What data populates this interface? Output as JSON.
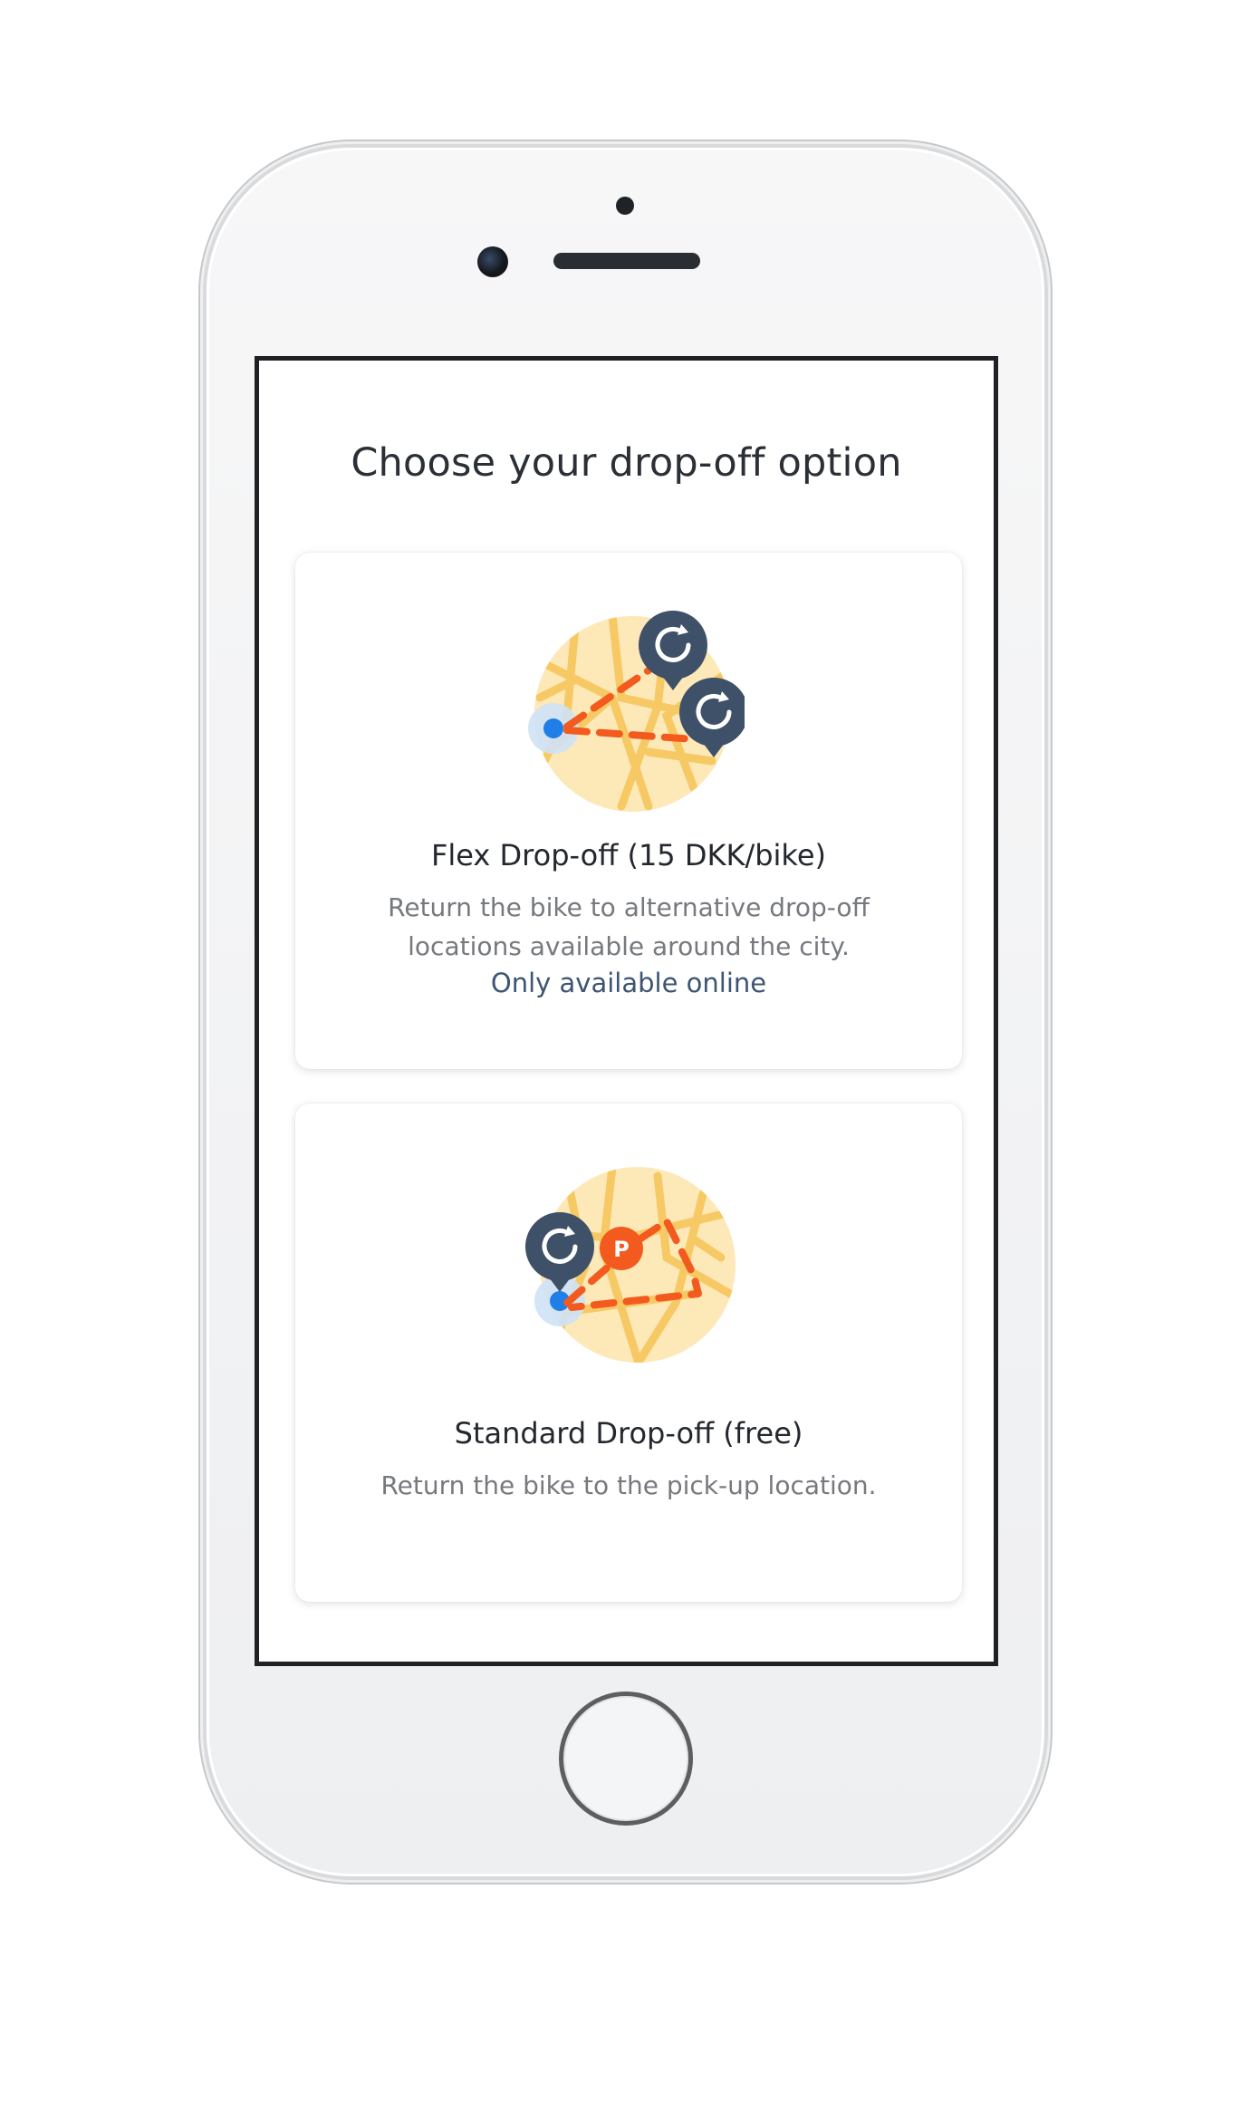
{
  "page": {
    "title": "Choose your drop-off option"
  },
  "options": [
    {
      "title": "Flex Drop-off (15 DKK/bike)",
      "description": "Return the bike to alternative drop-off locations available around the city.",
      "note": "Only available online",
      "illustration": "map-flex-dropoff-icon"
    },
    {
      "title": "Standard Drop-off (free)",
      "description": "Return the bike to the pick-up location.",
      "illustration": "map-standard-dropoff-icon"
    }
  ],
  "colors": {
    "title_text": "#2b2f36",
    "description_text": "#76797e",
    "note_text": "#3d5573",
    "map_fill": "#fde8b8",
    "map_roads": "#f6c964",
    "route": "#f25a1e",
    "pin": "#3f5069",
    "location_dot": "#1f7ee8"
  }
}
